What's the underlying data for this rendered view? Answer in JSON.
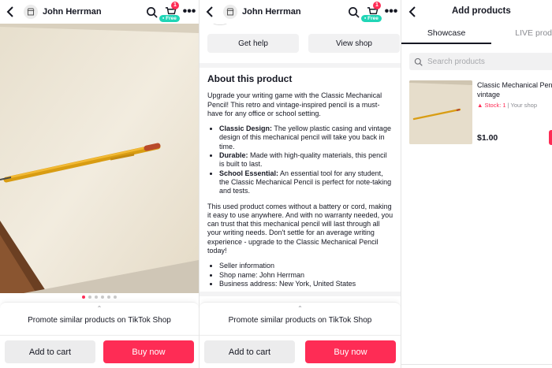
{
  "colors": {
    "accent": "#fe2c55",
    "free_badge": "#20d5b6"
  },
  "product_page": {
    "shop_name": "John Herrman",
    "cart_badge": "1",
    "free_label": "Free",
    "more_label": "•••",
    "carousel": {
      "total": 6,
      "active": 1
    },
    "promote_chevron": "⌃",
    "promote_label": "Promote similar products on TikTok Shop",
    "add_to_cart": "Add to cart",
    "buy_now": "Buy now"
  },
  "details_page": {
    "shop_name": "John Herrman",
    "cart_badge": "1",
    "free_label": "Free",
    "more_label": "•••",
    "get_help": "Get help",
    "view_shop": "View shop",
    "about_title": "About this product",
    "intro": "Upgrade your writing game with the Classic Mechanical Pencil! This retro and vintage-inspired pencil is a must-have for any office or school setting.",
    "features": [
      {
        "label": "Classic Design:",
        "text": " The yellow plastic casing and vintage design of this mechanical pencil will take you back in time."
      },
      {
        "label": "Durable:",
        "text": " Made with high-quality materials, this pencil is built to last."
      },
      {
        "label": "School Essential:",
        "text": " An essential tool for any student, the Classic Mechanical Pencil is perfect for note-taking and tests."
      }
    ],
    "body": "This used product comes without a battery or cord, making it easy to use anywhere. And with no warranty needed, you can trust that this mechanical pencil will last through all your writing needs. Don't settle for an average writing experience - upgrade to the Classic Mechanical Pencil today!",
    "seller": [
      "Seller information",
      "Shop name: John Herrman",
      "Business address: New York, United States"
    ],
    "promote_chevron": "⌃",
    "promote_label": "Promote similar products on TikTok Shop",
    "add_to_cart": "Add to cart",
    "buy_now": "Buy now"
  },
  "add_products": {
    "title": "Add products",
    "tabs": [
      "Showcase",
      "LIVE prod"
    ],
    "search_placeholder": "Search products",
    "product": {
      "title": "Classic Mechanical Penc vintage",
      "stock": "Stock: 1",
      "separator": "|",
      "source": "Your shop",
      "price": "$1.00"
    }
  },
  "icons": [
    "back-arrow-icon",
    "shop-icon",
    "search-icon",
    "cart-icon",
    "more-icon",
    "warning-icon",
    "chevron-up-icon"
  ]
}
